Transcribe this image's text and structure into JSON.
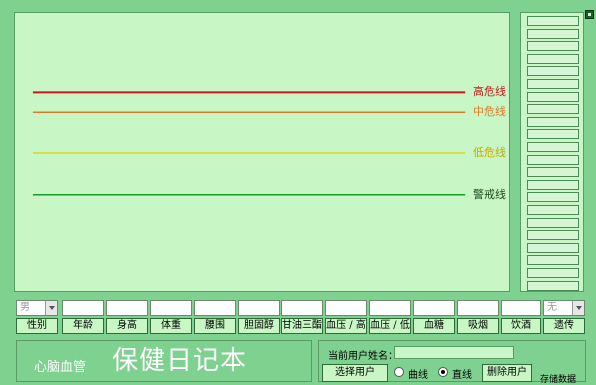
{
  "chart_data": {
    "type": "line",
    "title": "",
    "threshold_lines": [
      {
        "label": "高危线",
        "color": "#c81818"
      },
      {
        "label": "中危线",
        "color": "#e0782a"
      },
      {
        "label": "低危线",
        "color": "#d8d820"
      },
      {
        "label": "警戒线",
        "color": "#1a9a2a"
      }
    ],
    "grid": false
  },
  "side_panel": {
    "cell_count": 22
  },
  "inputs": {
    "gender_value": "男",
    "last_value": "无"
  },
  "columns": [
    {
      "label": "性别"
    },
    {
      "label": "年龄"
    },
    {
      "label": "身高"
    },
    {
      "label": "体重"
    },
    {
      "label": "腰围"
    },
    {
      "label": "胆固醇"
    },
    {
      "label": "甘油三酯"
    },
    {
      "label": "血压 / 高"
    },
    {
      "label": "血压 / 低"
    },
    {
      "label": "血糖"
    },
    {
      "label": "吸烟"
    },
    {
      "label": "饮酒"
    },
    {
      "label": "遗传"
    }
  ],
  "app": {
    "title_small": "心脑血管",
    "title_big": "保健日记本"
  },
  "user_panel": {
    "current_user_label": "当前用户姓名：",
    "current_user_name": "",
    "choose_user": "选择用户",
    "radio_curve": "曲线",
    "radio_line": "直线",
    "selected": "直线",
    "delete_user": "删除用户",
    "save_data": "存储数据"
  }
}
